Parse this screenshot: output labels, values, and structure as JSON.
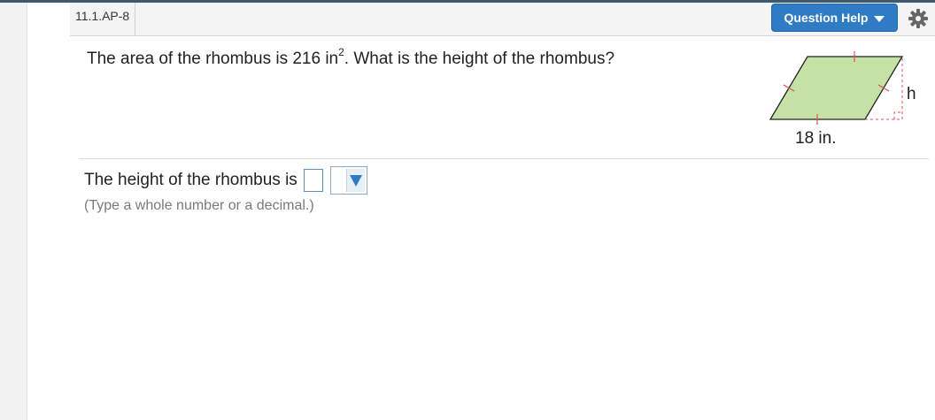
{
  "header": {
    "question_id": "11.1.AP-8",
    "help_button_label": "Question Help",
    "settings_icon": "gear-icon"
  },
  "question": {
    "text_before": "The area of the rhombus is 216 in",
    "superscript": "2",
    "text_after": ". What is the height of the rhombus?"
  },
  "figure": {
    "base_label": "18 in.",
    "height_label": "h",
    "fill_color": "#c5e1a5",
    "tick_color": "#d9534f"
  },
  "answer": {
    "prompt": "The height of the rhombus is",
    "value": "",
    "unit_selected": "",
    "hint": "(Type a whole number or a decimal.)"
  },
  "colors": {
    "accent": "#2f7bc4",
    "header_bg": "#f4f4f4"
  }
}
